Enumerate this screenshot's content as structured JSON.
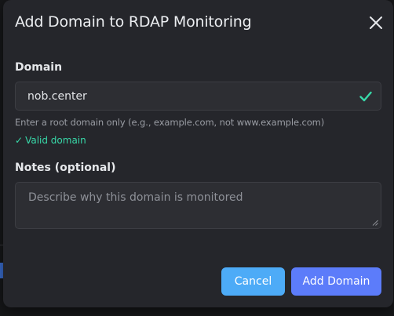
{
  "modal": {
    "title": "Add Domain to RDAP Monitoring"
  },
  "domain_field": {
    "label": "Domain",
    "value": "nob.center",
    "helper": "Enter a root domain only (e.g., example.com, not www.example.com)",
    "validation_tick": "✓",
    "validation_text": "Valid domain",
    "status": "valid"
  },
  "notes_field": {
    "label": "Notes (optional)",
    "placeholder": "Describe why this domain is monitored",
    "value": ""
  },
  "actions": {
    "cancel_label": "Cancel",
    "submit_label": "Add Domain"
  },
  "icons": {
    "close": "close-icon",
    "valid": "check-icon",
    "resize": "resize-handle-icon"
  },
  "colors": {
    "modal_bg": "#25262b",
    "input_bg": "#2d2e33",
    "valid": "#38d9a9",
    "cancel_button": "#4dabf7",
    "submit_button": "#5c7cfa"
  }
}
